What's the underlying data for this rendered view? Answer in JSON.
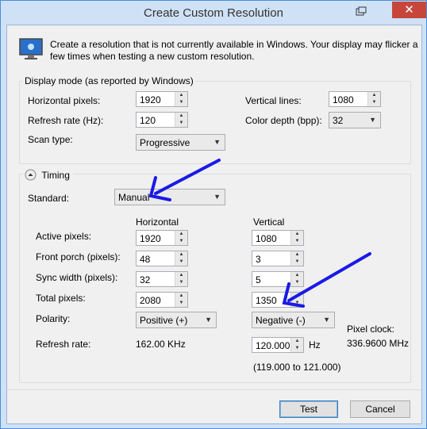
{
  "window": {
    "title": "Create Custom Resolution",
    "close_glyph": "✕",
    "accent": "#4a8fd6",
    "close_color": "#c7463b"
  },
  "intro": {
    "text_line1": "Create a resolution that is not currently available in Windows. Your display may flicker a",
    "text_line2": "few times when testing a new custom resolution.",
    "icon": "monitor-icon"
  },
  "display_mode": {
    "group_title": "Display mode (as reported by Windows)",
    "horizontal_pixels_label": "Horizontal pixels:",
    "horizontal_pixels_value": "1920",
    "refresh_rate_label": "Refresh rate (Hz):",
    "refresh_rate_value": "120",
    "scan_type_label": "Scan type:",
    "scan_type_value": "Progressive",
    "vertical_lines_label": "Vertical lines:",
    "vertical_lines_value": "1080",
    "color_depth_label": "Color depth (bpp):",
    "color_depth_value": "32"
  },
  "timing": {
    "group_title": "Timing",
    "standard_label": "Standard:",
    "standard_value": "Manual",
    "horizontal_header": "Horizontal",
    "vertical_header": "Vertical",
    "rows": [
      {
        "label": "Active pixels:",
        "h": "1920",
        "v": "1080"
      },
      {
        "label": "Front porch (pixels):",
        "h": "48",
        "v": "3"
      },
      {
        "label": "Sync width (pixels):",
        "h": "32",
        "v": "5"
      },
      {
        "label": "Total pixels:",
        "h": "2080",
        "v": "1350"
      }
    ],
    "polarity_label": "Polarity:",
    "polarity_h": "Positive (+)",
    "polarity_v": "Negative (-)",
    "refresh_label": "Refresh rate:",
    "refresh_h": "162.00 KHz",
    "refresh_v": "120.000",
    "refresh_unit": "Hz",
    "refresh_range": "(119.000 to 121.000)",
    "pixel_clock_label": "Pixel clock:",
    "pixel_clock_value": "336.9600 MHz"
  },
  "buttons": {
    "test": "Test",
    "cancel": "Cancel"
  },
  "annotation_color": "#1a1ae6"
}
